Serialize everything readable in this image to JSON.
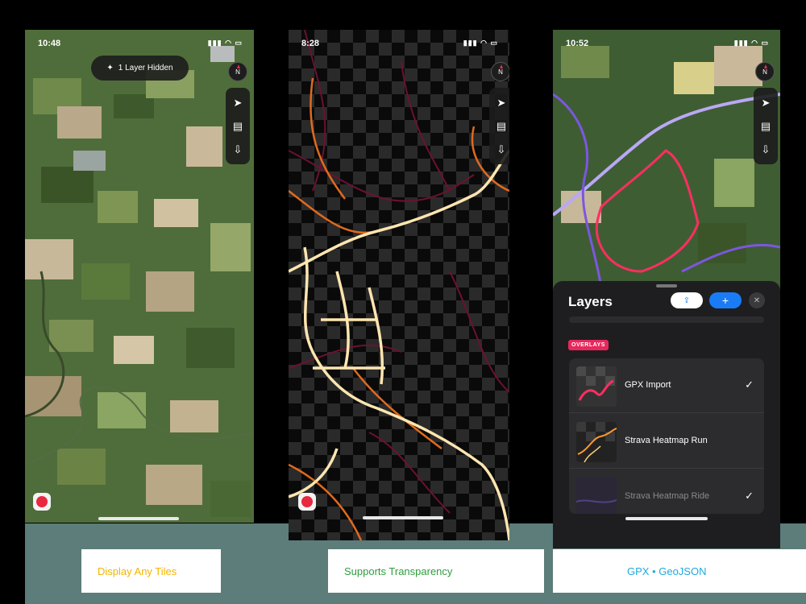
{
  "screen1": {
    "status_time": "10:48",
    "status_icons": "▮▮▮ ◠ ▭",
    "hidden_pill": "1 Layer Hidden",
    "caption": "Display Any Tiles"
  },
  "screen2": {
    "status_time": "8:28",
    "status_icons": "▮▮▮ ◠ ▭",
    "caption": "Supports Transparency"
  },
  "screen3": {
    "status_time": "10:52",
    "status_icons": "▮▮▮ ◠ ▭",
    "caption": "GPX • GeoJSON",
    "sheet": {
      "title": "Layers",
      "share_glyph": "⇪",
      "add_glyph": "+",
      "close_glyph": "✕",
      "section_badge": "OVERLAYS",
      "layers": [
        {
          "name": "GPX Import",
          "checked": "✓"
        },
        {
          "name": "Strava Heatmap Run",
          "checked": ""
        },
        {
          "name": "Strava Heatmap Ride",
          "checked": "✓"
        }
      ]
    }
  },
  "toolbar": {
    "compass_label": "N",
    "locate_glyph": "➤",
    "map_glyph": "▤",
    "download_glyph": "⇩"
  },
  "colors": {
    "accent_red": "#e8283f",
    "blue": "#1a7cf5",
    "gpx_track": "#ff2e62",
    "heatmap": "#ff9a2e"
  }
}
